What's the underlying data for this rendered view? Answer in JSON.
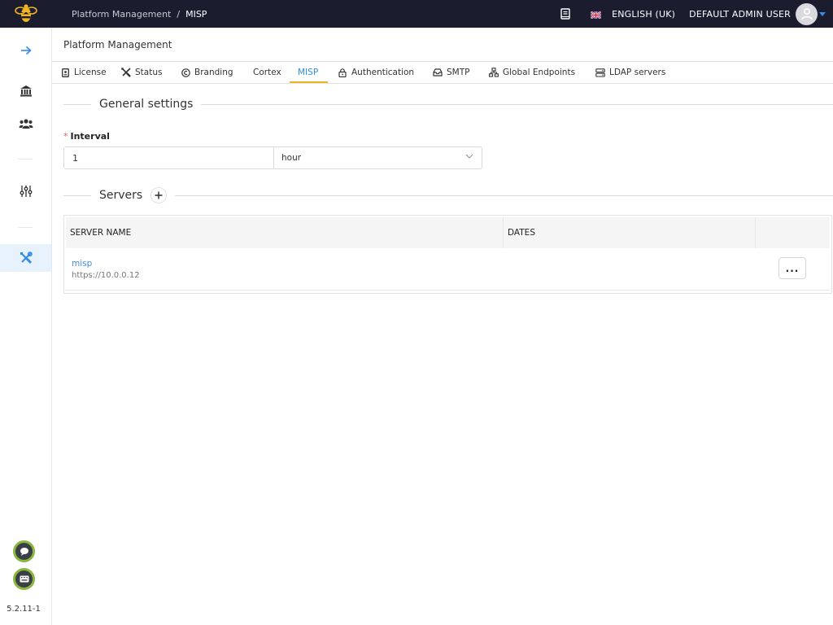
{
  "header": {
    "breadcrumb_parent": "Platform Management",
    "breadcrumb_separator": "/",
    "breadcrumb_current": "MISP",
    "language": "ENGLISH (UK)",
    "user": "DEFAULT ADMIN USER",
    "icons": [
      "bee-logo-icon",
      "documentation-icon",
      "uk-flag-icon",
      "user-avatar-icon",
      "caret-down-icon"
    ]
  },
  "sidebar": {
    "items": [
      {
        "name": "expand-arrow-icon",
        "active": false
      },
      {
        "name": "organisation-icon",
        "active": false
      },
      {
        "name": "users-icon",
        "active": false
      },
      {
        "name": "settings-sliders-icon",
        "active": false
      },
      {
        "name": "platform-management-icon",
        "active": true
      }
    ],
    "bottom_buttons": [
      "chat-bubble-icon",
      "keyboard-icon"
    ],
    "version": "5.2.11-1"
  },
  "page": {
    "title": "Platform Management"
  },
  "tabs": [
    {
      "label": "License",
      "icon": "license-icon",
      "active": false
    },
    {
      "label": "Status",
      "icon": "tools-icon",
      "active": false
    },
    {
      "label": "Branding",
      "icon": "copyright-icon",
      "active": false
    },
    {
      "label": "Cortex",
      "icon": "",
      "active": false
    },
    {
      "label": "MISP",
      "icon": "",
      "active": true
    },
    {
      "label": "Authentication",
      "icon": "lock-icon",
      "active": false
    },
    {
      "label": "SMTP",
      "icon": "inbox-icon",
      "active": false
    },
    {
      "label": "Global Endpoints",
      "icon": "network-icon",
      "active": false
    },
    {
      "label": "LDAP servers",
      "icon": "server-icon",
      "active": false
    }
  ],
  "general_settings": {
    "title": "General settings",
    "interval_label": "Interval",
    "required_marker": "*",
    "interval_value": "1",
    "interval_unit": "hour"
  },
  "servers": {
    "title": "Servers",
    "columns": [
      "SERVER NAME",
      "DATES"
    ],
    "rows": [
      {
        "name": "misp",
        "url": "https://10.0.0.12",
        "dates": "",
        "action": "..."
      }
    ]
  },
  "colors": {
    "topbar": "#1b1d2e",
    "accent_blue": "#2f8be6",
    "tab_underline": "#f0b323",
    "required_star": "#f05a5a",
    "round_button_border": "#8ab83d"
  }
}
